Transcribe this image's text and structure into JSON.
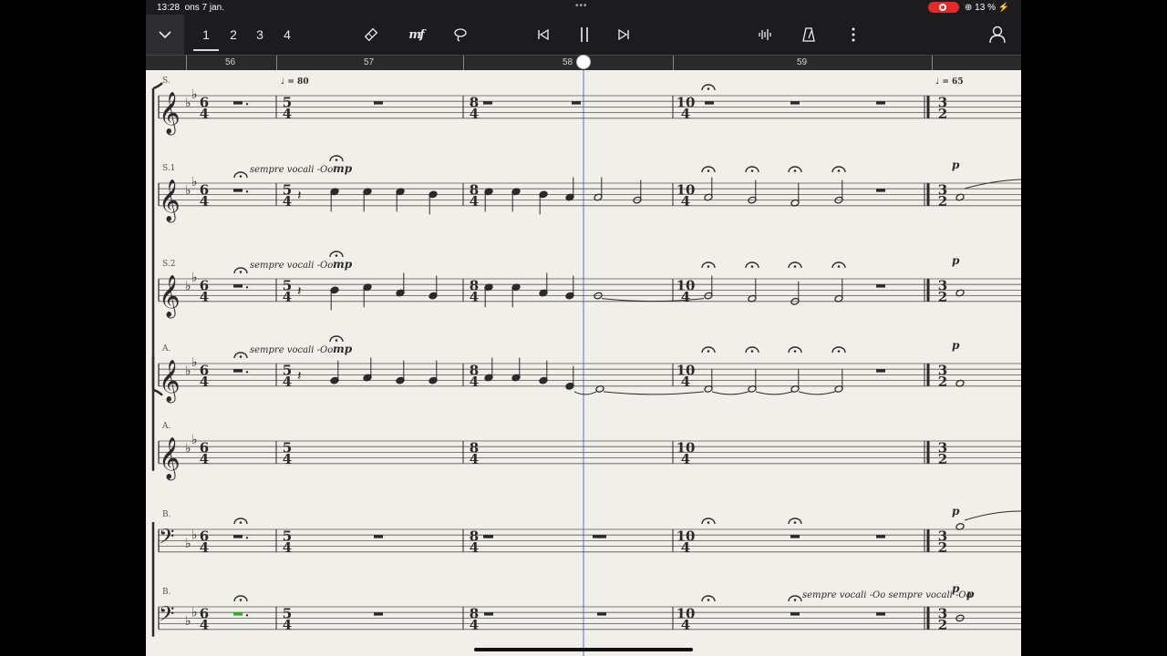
{
  "statusbar": {
    "time": "13:28",
    "date": "ons 7 jan.",
    "battery": "13 %"
  },
  "toolbar": {
    "pages": [
      "1",
      "2",
      "3",
      "4"
    ],
    "active_page": "1",
    "icons": [
      "chevron-down-icon",
      "eraser-icon",
      "dynamics-tool-icon",
      "lasso-icon",
      "skip-back-icon",
      "pause-icon",
      "skip-forward-icon",
      "waveform-icon",
      "metronome-icon",
      "more-icon",
      "user-icon"
    ]
  },
  "ruler": {
    "measures": [
      "56",
      "57",
      "58",
      "59"
    ]
  },
  "score": {
    "tempo_1": "♩ = 80",
    "tempo_2": "♩ = 65",
    "staves": [
      {
        "label": "S."
      },
      {
        "label": "S.1",
        "text": "sempre vocali -Oo",
        "dyn": "mp",
        "dyn_end": "p"
      },
      {
        "label": "S.2",
        "text": "sempre vocali -Oo",
        "dyn": "mp",
        "dyn_end": "p"
      },
      {
        "label": "A.",
        "text": "sempre vocali -Oo",
        "dyn": "mp",
        "dyn_end": "p"
      },
      {
        "label": "A."
      },
      {
        "label": "B.",
        "dyn_end": "p"
      },
      {
        "label": "B.",
        "text_end": "sempre vocali -Oo sempre vocali -Oo",
        "dyn_end": "p"
      }
    ],
    "timesigs": [
      [
        "6",
        "4"
      ],
      [
        "5",
        "4"
      ],
      [
        "8",
        "4"
      ],
      [
        "10",
        "4"
      ],
      [
        "3",
        "2"
      ]
    ]
  }
}
